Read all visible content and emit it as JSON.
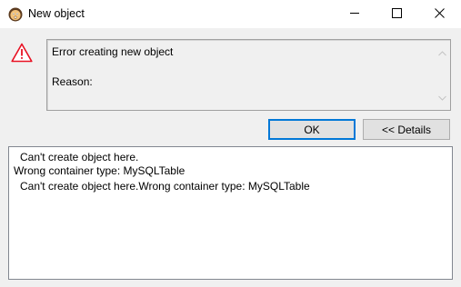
{
  "window": {
    "title": "New object",
    "icon": "dbeaver-beaver-icon"
  },
  "controls": {
    "minimize": "minimize-icon",
    "maximize": "maximize-icon",
    "close": "close-icon"
  },
  "message": {
    "icon": "warning-triangle-icon",
    "line1": "Error creating new object",
    "line2": "Reason:"
  },
  "buttons": {
    "ok_label": "OK",
    "details_label": "<< Details"
  },
  "details": {
    "lines": [
      "Can't create object here.",
      "Wrong container type: MySQLTable",
      "Can't create object here.Wrong container type: MySQLTable"
    ]
  },
  "colors": {
    "accent": "#0078d7",
    "warning": "#e81123"
  }
}
